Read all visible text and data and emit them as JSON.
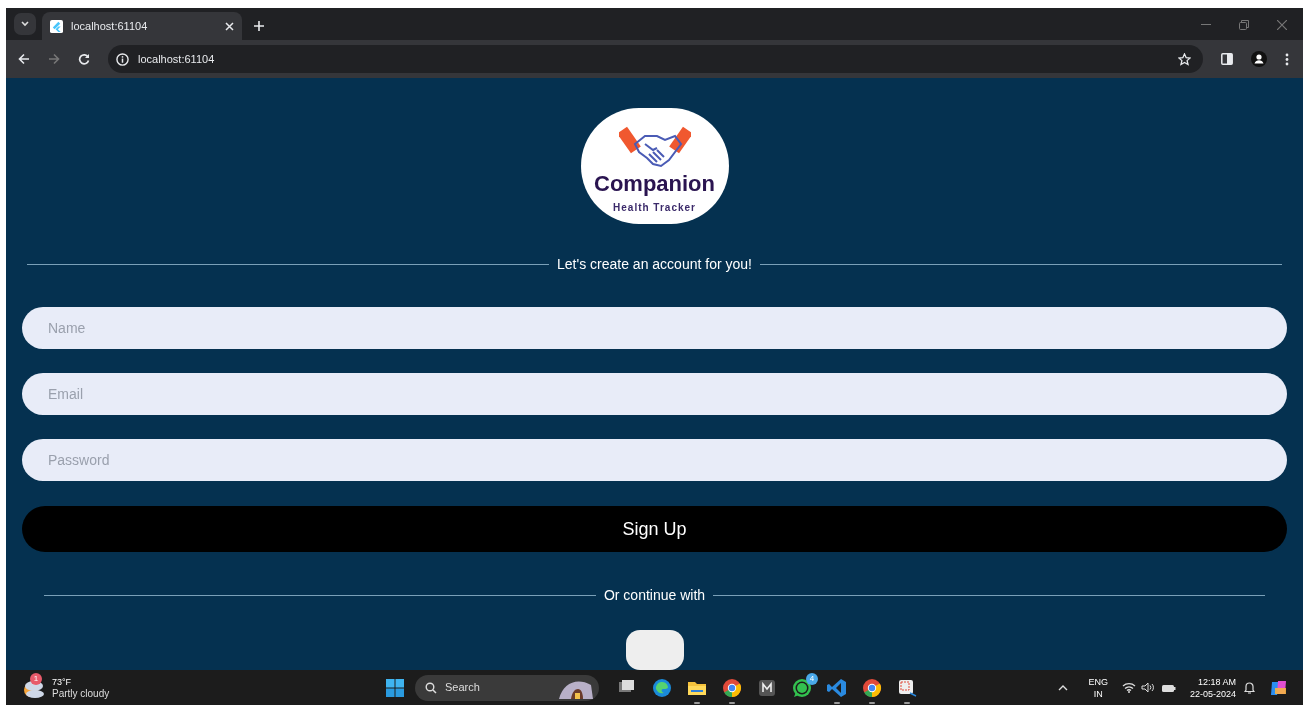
{
  "browser": {
    "tab": {
      "title": "localhost:61104",
      "selected": true
    },
    "url": "localhost:61104"
  },
  "logo": {
    "title": "Companion",
    "subtitle": "Health Tracker"
  },
  "heading": "Let's create an account for you!",
  "fields": [
    {
      "placeholder": "Name"
    },
    {
      "placeholder": "Email"
    },
    {
      "placeholder": "Password"
    }
  ],
  "submit_button": "Sign Up",
  "alt_divider": "Or continue with",
  "taskbar": {
    "weather": {
      "temperature": "73°F",
      "condition": "Partly cloudy",
      "badge": "1"
    },
    "search": {
      "placeholder": "Search"
    },
    "apps": [
      {
        "kind": "taskview",
        "running": false
      },
      {
        "kind": "edge",
        "running": false
      },
      {
        "kind": "files",
        "running": true
      },
      {
        "kind": "chrome",
        "running": true
      },
      {
        "kind": "dark",
        "running": false
      },
      {
        "kind": "whatsapp",
        "running": false,
        "badge": "4"
      },
      {
        "kind": "vscode",
        "running": true
      },
      {
        "kind": "chrome",
        "running": true
      },
      {
        "kind": "snip",
        "running": true
      }
    ],
    "language": "ENG",
    "region": "IN",
    "time": "12:18 AM",
    "date": "22-05-2024"
  }
}
